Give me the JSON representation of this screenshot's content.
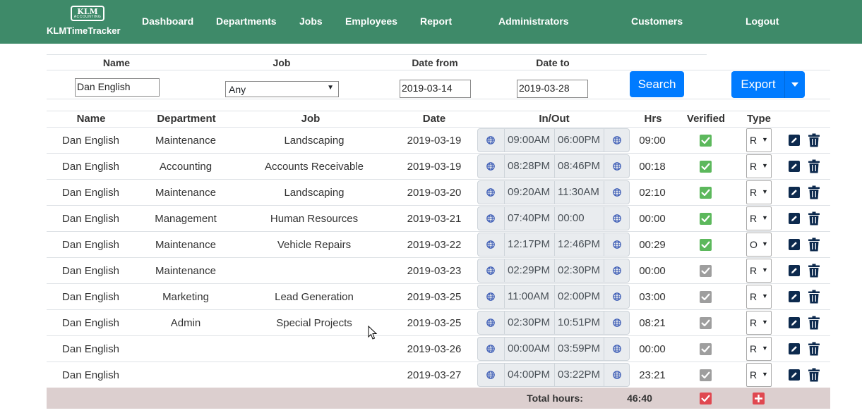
{
  "brand": {
    "logo_text": "KLM",
    "logo_sub": "ACCOUNTING",
    "name": "KLMTimeTracker"
  },
  "nav": {
    "dashboard": "Dashboard",
    "departments": "Departments",
    "jobs": "Jobs",
    "employees": "Employees",
    "report": "Report",
    "administrators": "Administrators",
    "customers": "Customers",
    "logout": "Logout"
  },
  "filter": {
    "name_label": "Name",
    "job_label": "Job",
    "date_from_label": "Date from",
    "date_to_label": "Date to",
    "name_value": "Dan English",
    "job_value": "Any",
    "date_from_value": "2019-03-14",
    "date_to_value": "2019-03-28",
    "search_label": "Search",
    "export_label": "Export"
  },
  "table": {
    "headers": {
      "name": "Name",
      "department": "Department",
      "job": "Job",
      "date": "Date",
      "inout": "In/Out",
      "hrs": "Hrs",
      "verified": "Verified",
      "type": "Type"
    },
    "rows": [
      {
        "name": "Dan English",
        "department": "Maintenance",
        "job": "Landscaping",
        "date": "2019-03-19",
        "in": "09:00AM",
        "out": "06:00PM",
        "hrs": "09:00",
        "verified": true,
        "type": "R"
      },
      {
        "name": "Dan English",
        "department": "Accounting",
        "job": "Accounts Receivable",
        "date": "2019-03-19",
        "in": "08:28PM",
        "out": "08:46PM",
        "hrs": "00:18",
        "verified": true,
        "type": "R"
      },
      {
        "name": "Dan English",
        "department": "Maintenance",
        "job": "Landscaping",
        "date": "2019-03-20",
        "in": "09:20AM",
        "out": "11:30AM",
        "hrs": "02:10",
        "verified": true,
        "type": "R"
      },
      {
        "name": "Dan English",
        "department": "Management",
        "job": "Human Resources",
        "date": "2019-03-21",
        "in": "07:40PM",
        "out": "00:00",
        "hrs": "00:00",
        "verified": true,
        "type": "R"
      },
      {
        "name": "Dan English",
        "department": "Maintenance",
        "job": "Vehicle Repairs",
        "date": "2019-03-22",
        "in": "12:17PM",
        "out": "12:46PM",
        "hrs": "00:29",
        "verified": true,
        "type": "O"
      },
      {
        "name": "Dan English",
        "department": "Maintenance",
        "job": "",
        "date": "2019-03-23",
        "in": "02:29PM",
        "out": "02:30PM",
        "hrs": "00:00",
        "verified": false,
        "type": "R"
      },
      {
        "name": "Dan English",
        "department": "Marketing",
        "job": "Lead Generation",
        "date": "2019-03-25",
        "in": "11:00AM",
        "out": "02:00PM",
        "hrs": "03:00",
        "verified": false,
        "type": "R"
      },
      {
        "name": "Dan English",
        "department": "Admin",
        "job": "Special Projects",
        "date": "2019-03-25",
        "in": "02:30PM",
        "out": "10:51PM",
        "hrs": "08:21",
        "verified": false,
        "type": "R"
      },
      {
        "name": "Dan English",
        "department": "",
        "job": "",
        "date": "2019-03-26",
        "in": "00:00AM",
        "out": "03:59PM",
        "hrs": "00:00",
        "verified": false,
        "type": "R"
      },
      {
        "name": "Dan English",
        "department": "",
        "job": "",
        "date": "2019-03-27",
        "in": "04:00PM",
        "out": "03:22PM",
        "hrs": "23:21",
        "verified": false,
        "type": "R"
      }
    ],
    "total_label": "Total hours:",
    "total_value": "46:40"
  },
  "colors": {
    "nav": "#3e8a69",
    "primary": "#007bff",
    "verified": "#5cb85c",
    "unverified": "#9e9e9e",
    "action": "#0d2a4e",
    "footer": "#dccfcf",
    "danger": "#dc3545"
  },
  "icons": [
    "globe-icon",
    "check-icon",
    "edit-icon",
    "trash-icon",
    "plus-icon",
    "caret-down-icon"
  ]
}
